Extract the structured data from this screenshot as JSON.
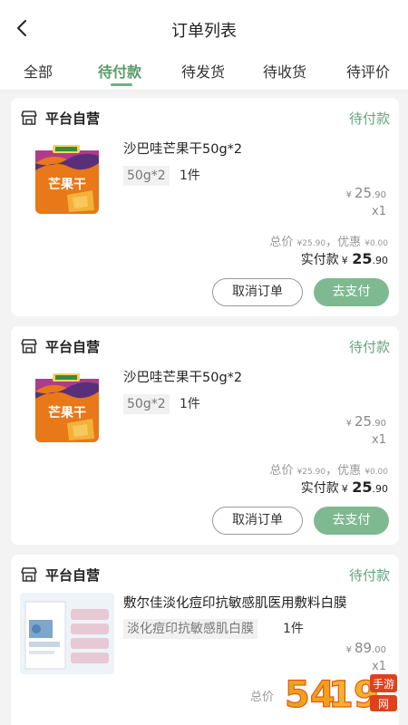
{
  "header": {
    "title": "订单列表"
  },
  "tabs": [
    {
      "label": "全部"
    },
    {
      "label": "待付款"
    },
    {
      "label": "待发货"
    },
    {
      "label": "待收货"
    },
    {
      "label": "待评价"
    }
  ],
  "active_tab": "待付款",
  "colors": {
    "accent": "#67a37c",
    "pay_button": "#7fb991",
    "background": "#f3f3f3"
  },
  "orders": [
    {
      "store": "平台自营",
      "status": "待付款",
      "product": {
        "name": "沙巴哇芒果干50g*2",
        "spec": "50g*2",
        "quantity": "1件",
        "image_icon": "dried-mango-pack",
        "image_text": "芒果干"
      },
      "price": {
        "currency": "¥",
        "int": "25",
        "dec": ".90"
      },
      "multiplier": "x1",
      "summary": {
        "total_label": "总价",
        "total": "¥25.90",
        "sep": "，",
        "discount_label": "优惠",
        "discount": "¥0.00"
      },
      "paid": {
        "label": "实付款",
        "currency": "¥",
        "int": "25",
        "dec": ".90"
      },
      "buttons": {
        "cancel": "取消订单",
        "pay": "去支付"
      }
    },
    {
      "store": "平台自营",
      "status": "待付款",
      "product": {
        "name": "沙巴哇芒果干50g*2",
        "spec": "50g*2",
        "quantity": "1件",
        "image_icon": "dried-mango-pack",
        "image_text": "芒果干"
      },
      "price": {
        "currency": "¥",
        "int": "25",
        "dec": ".90"
      },
      "multiplier": "x1",
      "summary": {
        "total_label": "总价",
        "total": "¥25.90",
        "sep": "，",
        "discount_label": "优惠",
        "discount": "¥0.00"
      },
      "paid": {
        "label": "实付款",
        "currency": "¥",
        "int": "25",
        "dec": ".90"
      },
      "buttons": {
        "cancel": "取消订单",
        "pay": "去支付"
      }
    },
    {
      "store": "平台自营",
      "status": "待付款",
      "product": {
        "name": "敷尔佳淡化痘印抗敏感肌医用敷料白膜",
        "spec": "淡化痘印抗敏感肌白膜",
        "quantity": "1件",
        "image_icon": "facial-mask-box"
      },
      "price": {
        "currency": "¥",
        "int": "89",
        "dec": ".00"
      },
      "multiplier": "x1",
      "summary": {
        "total_label": "总价"
      }
    }
  ],
  "watermark": {
    "text": "5419手游网"
  }
}
